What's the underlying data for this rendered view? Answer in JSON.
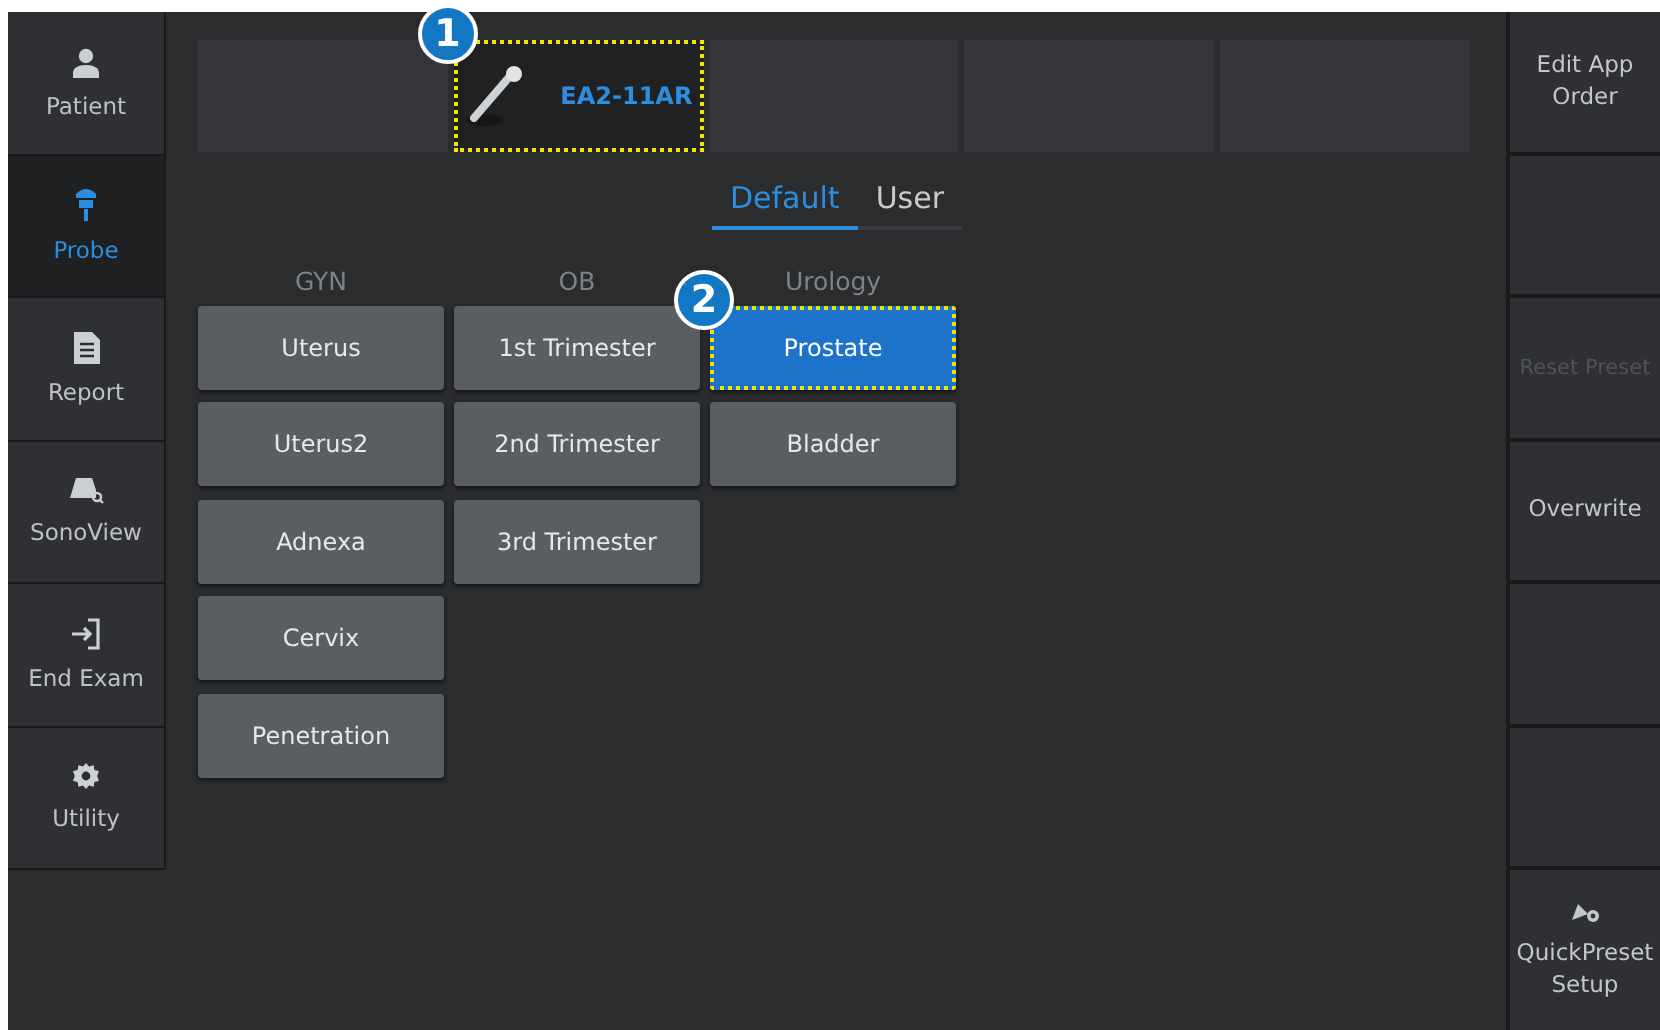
{
  "sidebar": {
    "items": [
      {
        "label": "Patient",
        "selected": false
      },
      {
        "label": "Probe",
        "selected": true
      },
      {
        "label": "Report",
        "selected": false
      },
      {
        "label": "SonoView",
        "selected": false
      },
      {
        "label": "End Exam",
        "selected": false
      },
      {
        "label": "Utility",
        "selected": false
      }
    ]
  },
  "probe_slots": [
    {
      "kind": "empty"
    },
    {
      "kind": "probe",
      "label": "EA2-11AR",
      "selected": true,
      "callout": "1"
    },
    {
      "kind": "empty"
    },
    {
      "kind": "empty"
    },
    {
      "kind": "empty"
    }
  ],
  "tabs": [
    {
      "label": "Default",
      "selected": true
    },
    {
      "label": "User",
      "selected": false
    }
  ],
  "preset_columns": [
    {
      "heading": "GYN",
      "presets": [
        {
          "label": "Uterus",
          "selected": false
        },
        {
          "label": "Uterus2",
          "selected": false
        },
        {
          "label": "Adnexa",
          "selected": false
        },
        {
          "label": "Cervix",
          "selected": false
        },
        {
          "label": "Penetration",
          "selected": false
        }
      ]
    },
    {
      "heading": "OB",
      "presets": [
        {
          "label": "1st Trimester",
          "selected": false
        },
        {
          "label": "2nd Trimester",
          "selected": false
        },
        {
          "label": "3rd Trimester",
          "selected": false
        }
      ]
    },
    {
      "heading": "Urology",
      "presets": [
        {
          "label": "Prostate",
          "selected": true,
          "callout": "2"
        },
        {
          "label": "Bladder",
          "selected": false
        }
      ]
    }
  ],
  "right_panel": [
    {
      "kind": "text",
      "label": "Edit App Order",
      "disabled": false
    },
    {
      "kind": "blank"
    },
    {
      "kind": "text",
      "label": "Reset Preset",
      "disabled": true
    },
    {
      "kind": "text",
      "label": "Overwrite",
      "disabled": false
    },
    {
      "kind": "blank"
    },
    {
      "kind": "blank"
    },
    {
      "kind": "icon",
      "label": "QuickPreset Setup",
      "disabled": false
    }
  ]
}
